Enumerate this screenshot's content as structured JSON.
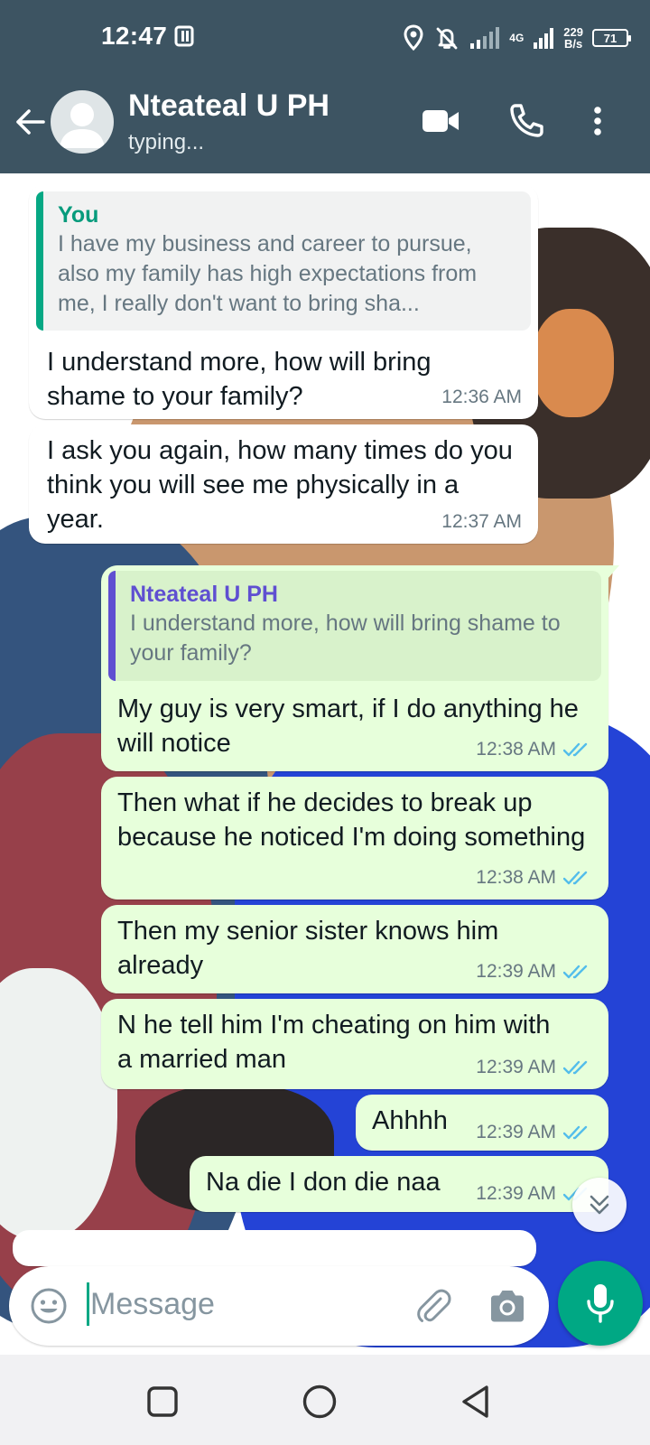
{
  "status_bar": {
    "time": "12:47",
    "speed_value": "229",
    "speed_unit": "B/s",
    "network": "4G",
    "battery": "71"
  },
  "header": {
    "contact_name": "Nteateal U PH",
    "contact_status": "typing..."
  },
  "messages": [
    {
      "direction": "in",
      "quote_author": "You",
      "quote_text": "I have my business and career to pursue, also my family has high expectations from me, I really don't want to bring sha...",
      "text": "I understand more, how will bring shame to your family?",
      "time": "12:36 AM"
    },
    {
      "direction": "in",
      "text": "I ask you again, how many times do you think you will see me physically in a year.",
      "time": "12:37 AM"
    },
    {
      "direction": "out",
      "quote_author": "Nteateal U PH",
      "quote_text": "I understand more, how will bring shame to your family?",
      "text": "My guy is very smart, if I do anything he will notice",
      "time": "12:38 AM",
      "status": "read"
    },
    {
      "direction": "out",
      "text": "Then what if he decides to break up because he noticed I'm doing something",
      "time": "12:38 AM",
      "status": "read"
    },
    {
      "direction": "out",
      "text": "Then my senior sister knows him already",
      "time": "12:39 AM",
      "status": "read"
    },
    {
      "direction": "out",
      "text": "N he tell him I'm cheating on him with a married man",
      "time": "12:39 AM",
      "status": "read"
    },
    {
      "direction": "out",
      "text": "Ahhhh",
      "time": "12:39 AM",
      "status": "read"
    },
    {
      "direction": "out",
      "text": "Na die I don die naa",
      "time": "12:39 AM",
      "status": "read"
    }
  ],
  "composer": {
    "placeholder": "Message"
  },
  "colors": {
    "header": "#3d5462",
    "accent": "#00a884",
    "outgoing_bubble": "#e7ffdb",
    "incoming_bubble": "#ffffff",
    "read_ticks": "#53bdeb"
  },
  "icons": [
    "back-arrow-icon",
    "avatar-placeholder-icon",
    "video-call-icon",
    "voice-call-icon",
    "more-options-icon",
    "emoji-icon",
    "attach-icon",
    "camera-icon",
    "mic-icon",
    "scroll-down-icon",
    "nav-recents-icon",
    "nav-home-icon",
    "nav-back-icon"
  ]
}
